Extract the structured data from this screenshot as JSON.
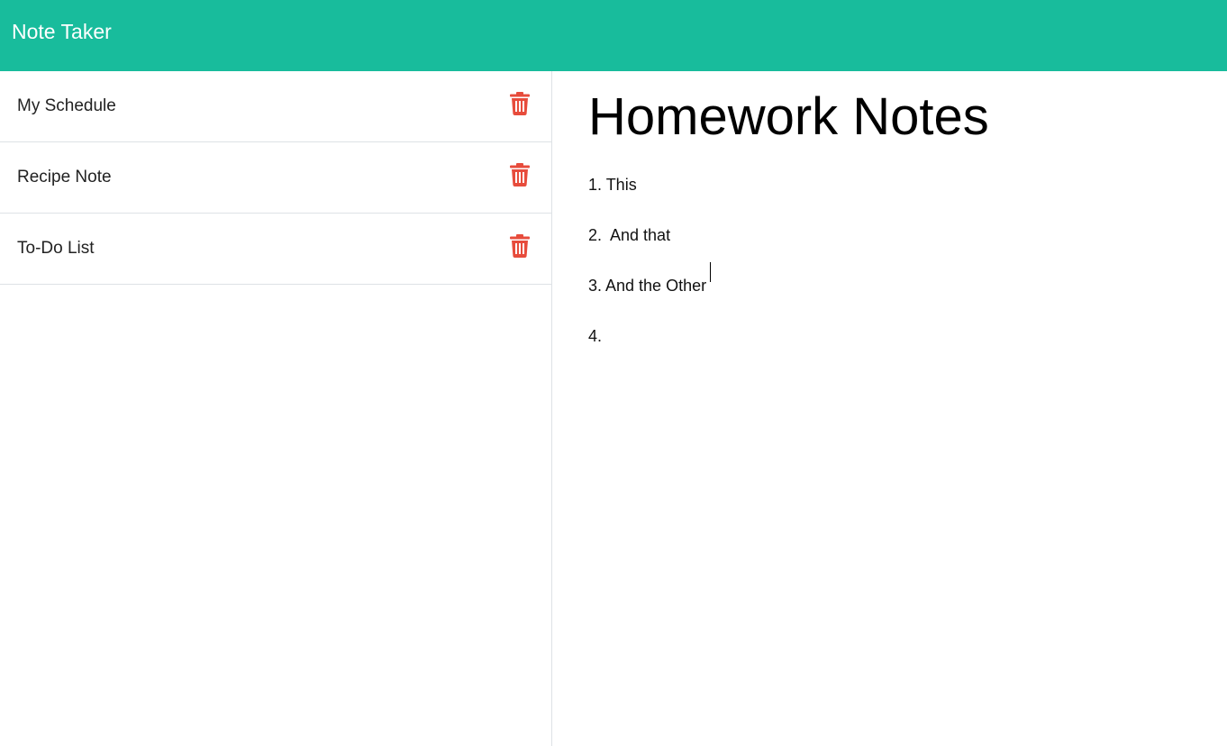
{
  "app": {
    "brand": "Note Taker"
  },
  "notes": [
    {
      "title": "My Schedule"
    },
    {
      "title": "Recipe Note"
    },
    {
      "title": "To-Do List"
    }
  ],
  "editor": {
    "title": "Homework Notes",
    "body": "1. This\n2.  And that\n3. And the Other\n4. "
  },
  "icons": {
    "delete": "trash-icon"
  },
  "colors": {
    "navbar": "#18bc9c",
    "delete": "#e74c3c",
    "divider": "#dee2e6"
  }
}
